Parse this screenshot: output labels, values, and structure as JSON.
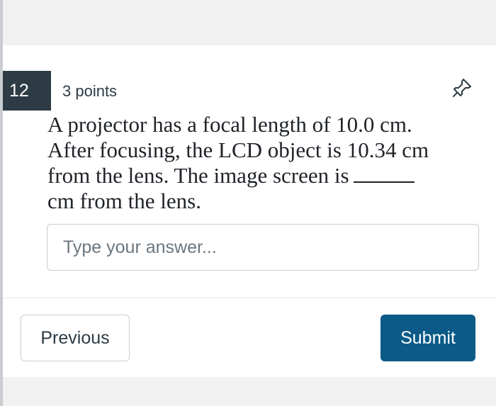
{
  "question": {
    "number": "12",
    "points": "3 points",
    "text_lines": [
      "A projector has a focal length of 10.0 cm.",
      "After focusing, the LCD object is 10.34 cm",
      "from the lens.  The image screen is",
      "cm from the lens."
    ],
    "pin_icon": "pin-icon"
  },
  "answer": {
    "value": "",
    "placeholder": "Type your answer..."
  },
  "nav": {
    "previous_label": "Previous",
    "submit_label": "Submit"
  },
  "colors": {
    "page_background": "#f1f1f2",
    "card_background": "#ffffff",
    "number_badge": "#2d3b45",
    "submit_button": "#0b5a87",
    "border": "#c7cdd1"
  }
}
